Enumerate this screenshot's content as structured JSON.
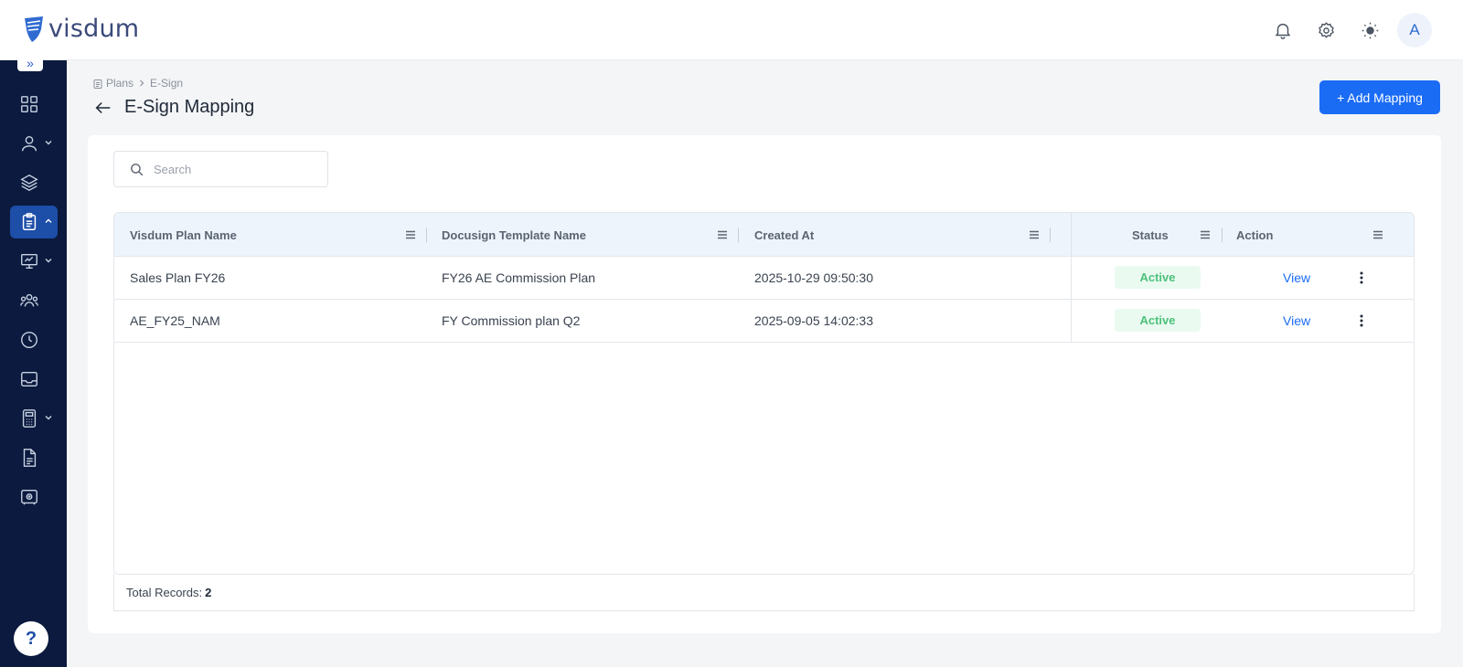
{
  "brand": {
    "name": "visdum"
  },
  "header": {
    "avatar_initial": "A"
  },
  "breadcrumb": {
    "items": [
      "Plans",
      "E-Sign"
    ]
  },
  "page": {
    "title": "E-Sign Mapping",
    "add_button": "+ Add Mapping"
  },
  "search": {
    "placeholder": "Search",
    "value": ""
  },
  "table": {
    "columns": [
      "Visdum Plan Name",
      "Docusign Template Name",
      "Created At",
      "Status",
      "Action"
    ],
    "rows": [
      {
        "plan": "Sales Plan FY26",
        "template": "FY26 AE Commission Plan",
        "created_at": "2025-10-29 09:50:30",
        "status": "Active",
        "action": "View"
      },
      {
        "plan": "AE_FY25_NAM",
        "template": "FY Commission plan Q2",
        "created_at": "2025-09-05 14:02:33",
        "status": "Active",
        "action": "View"
      }
    ]
  },
  "footer": {
    "label": "Total Records:",
    "count": "2"
  },
  "colors": {
    "sidebar": "#0b1a3e",
    "accent": "#1a6cf5",
    "active_nav": "#1d4ea8",
    "status_active": "#4cc27a"
  },
  "icons": {
    "header": [
      "bell-icon",
      "gear-icon",
      "sun-icon"
    ],
    "sidebar": [
      "dashboard-icon",
      "user-icon",
      "layers-icon",
      "clipboard-icon",
      "monitor-icon",
      "team-icon",
      "clock-icon",
      "inbox-icon",
      "calculator-icon",
      "document-icon",
      "safe-icon"
    ]
  },
  "help": {
    "label": "?"
  }
}
